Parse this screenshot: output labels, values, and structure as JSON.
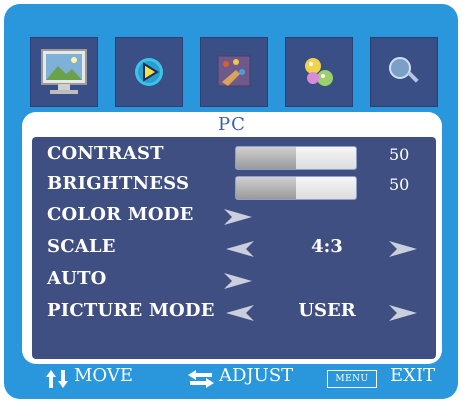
{
  "tabs": [
    {
      "icon": "monitor-picture-icon"
    },
    {
      "icon": "play-icon"
    },
    {
      "icon": "palette-icon"
    },
    {
      "icon": "settings-balls-icon"
    },
    {
      "icon": "magnifier-icon"
    }
  ],
  "source_title": "PC",
  "menu": {
    "contrast": {
      "label": "CONTRAST",
      "value": "50",
      "level": 0.5
    },
    "brightness": {
      "label": "BRIGHTNESS",
      "value": "50",
      "level": 0.5
    },
    "color_mode": {
      "label": "COLOR MODE"
    },
    "scale": {
      "label": "SCALE",
      "value": "4:3"
    },
    "auto": {
      "label": "AUTO"
    },
    "picture_mode": {
      "label": "PICTURE MODE",
      "value": "USER"
    }
  },
  "footer": {
    "move_label": "MOVE",
    "adjust_label": "ADJUST",
    "menu_key": "MENU",
    "exit_label": "EXIT"
  },
  "colors": {
    "frame": "#2a97dd",
    "menu_bg": "#3f4f82",
    "title": "#3c5fa8"
  }
}
